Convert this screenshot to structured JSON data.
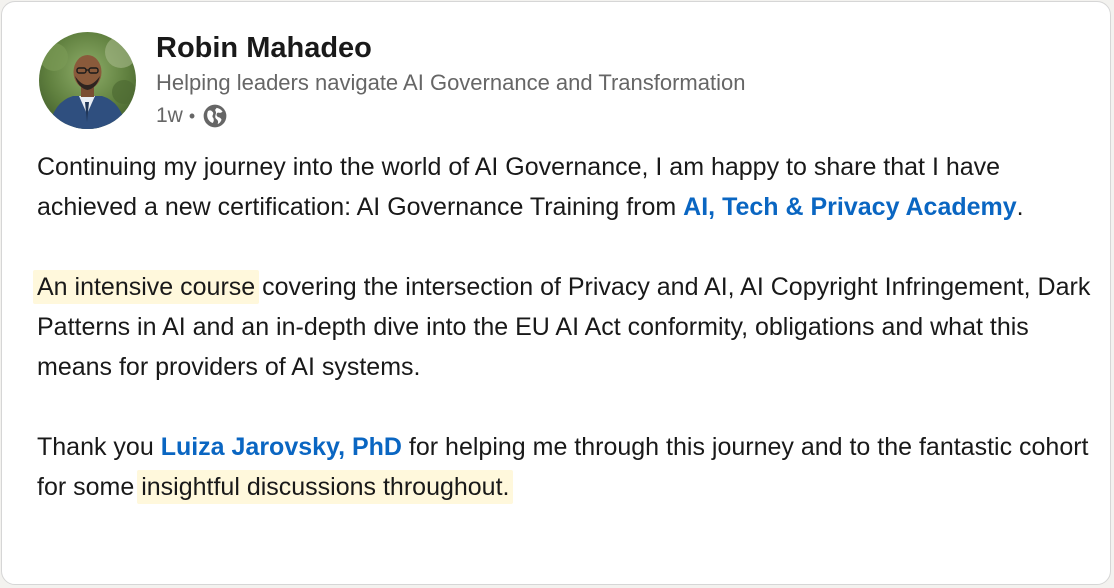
{
  "author": {
    "name": "Robin Mahadeo",
    "headline": "Helping leaders navigate AI Governance and Transformation",
    "time": "1w",
    "separator": "•",
    "visibility_icon": "globe-icon"
  },
  "post": {
    "p1_text": "Continuing my journey into the world of AI Governance, I am happy to share that I have achieved a new certification: AI Governance Training from ",
    "p1_mention": "AI, Tech & Privacy Academy",
    "p1_end": ".",
    "p2_highlight": "An intensive course",
    "p2_text": " covering the intersection of Privacy and AI, AI Copyright Infringement, Dark Patterns in AI and an in-depth dive into the EU AI Act conformity, obligations and what this means for providers of AI systems.",
    "p3_start": "Thank you ",
    "p3_mention": "Luiza Jarovsky, PhD",
    "p3_text": " for helping me through this journey and to the fantastic cohort for some ",
    "p3_highlight": "insightful discussions throughout."
  },
  "colors": {
    "mention": "#0a66c2",
    "highlight": "#fff8dc",
    "secondary_text": "#666666",
    "primary_text": "#191919"
  }
}
